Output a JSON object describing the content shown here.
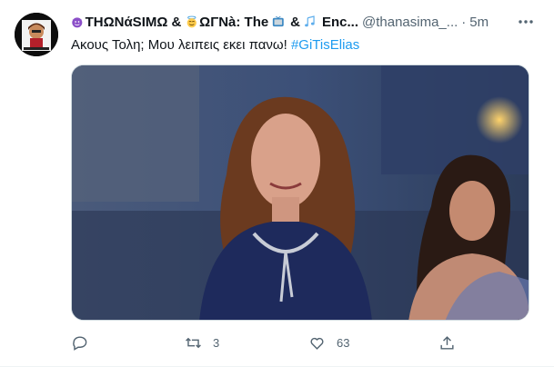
{
  "tweet": {
    "author": {
      "name_part1": "THΩNάSIMΩ",
      "sep1": " & ",
      "name_part2": "ΩΓΝà: The",
      "sep2": " & ",
      "name_part3": "Enc...",
      "handle": "@thanasima_...",
      "separator": "·",
      "time": "5m"
    },
    "text": "Ακους Τολη; Μου λειπεις εκει πανω!",
    "hashtag": "#GiTisElias",
    "actions": {
      "reply_count": "",
      "retweet_count": "3",
      "like_count": "63"
    },
    "icons": {
      "avatar": "profile-avatar",
      "emoji1": "smiling-devil-emoji",
      "emoji2": "angel-emoji",
      "emoji3": "tv-emoji",
      "emoji4": "musical-notes-emoji",
      "more": "more-icon",
      "reply": "reply-icon",
      "retweet": "retweet-icon",
      "like": "heart-icon",
      "share": "share-icon"
    },
    "colors": {
      "link": "#1d9bf0",
      "secondary_text": "#536471",
      "primary_text": "#0f1419"
    }
  }
}
